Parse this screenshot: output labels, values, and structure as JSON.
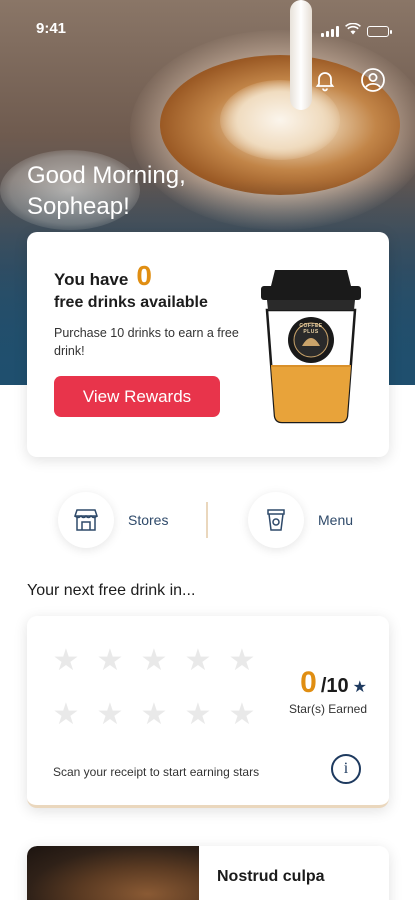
{
  "status": {
    "time": "9:41"
  },
  "header": {
    "greeting": "Good Morning,",
    "name": "Sopheap!"
  },
  "rewards": {
    "you_have": "You have",
    "count": "0",
    "free_label": "free drinks available",
    "purchase_text": "Purchase 10 drinks to earn a free drink!",
    "button_label": "View Rewards",
    "cup_brand": "COFFEE PLUS"
  },
  "quick_actions": [
    {
      "label": "Stores",
      "icon": "store-icon"
    },
    {
      "label": "Menu",
      "icon": "cup-icon"
    }
  ],
  "next_drink": {
    "title": "Your next free drink in...",
    "stars_total": 10,
    "stars_earned": 0,
    "earned_count": "0",
    "earned_total": "/10",
    "earned_label": "Star(s) Earned",
    "scan_text": "Scan your receipt to start earning stars"
  },
  "promo": {
    "title": "Nostrud culpa"
  },
  "colors": {
    "accent": "#e08e12",
    "button": "#e8344b",
    "navy": "#1e3a5f",
    "hero": "#1f4f6e"
  }
}
